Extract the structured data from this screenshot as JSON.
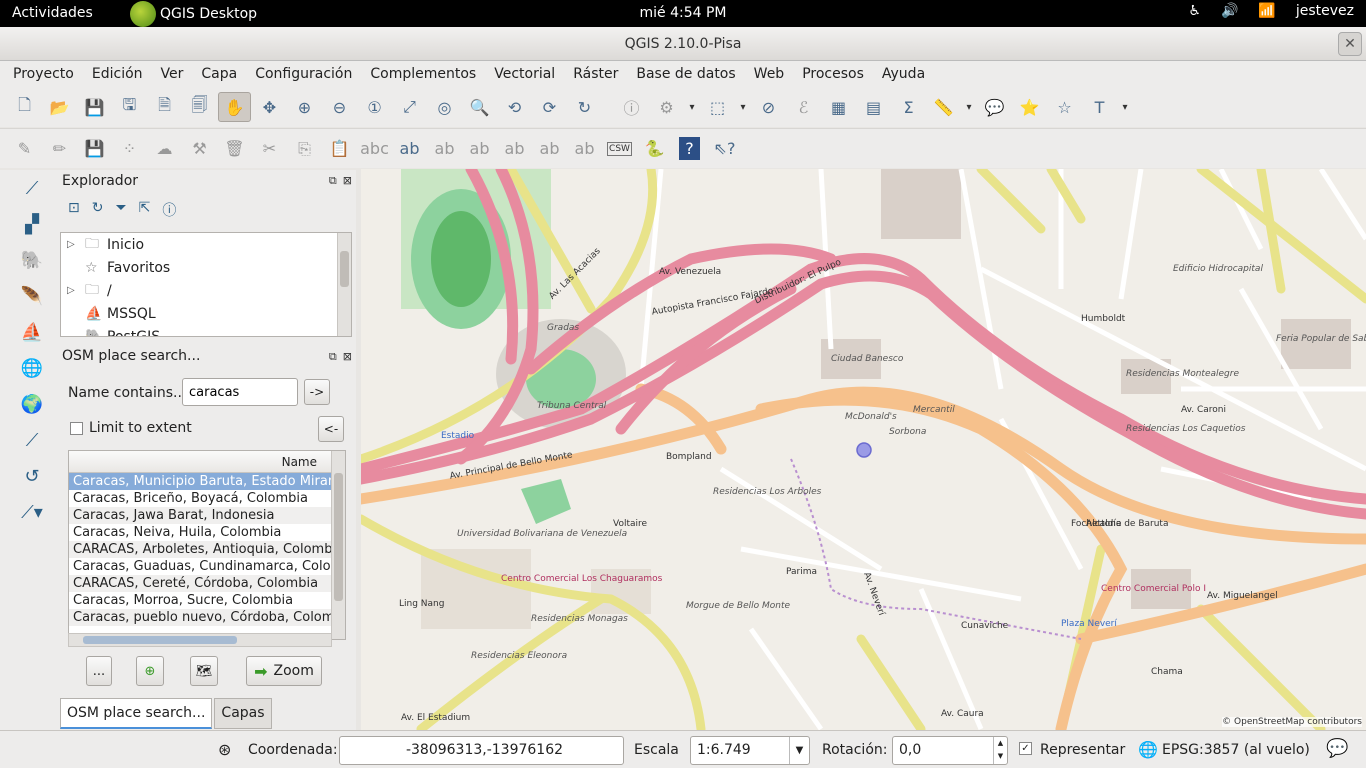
{
  "topbar": {
    "activities": "Actividades",
    "app_name": "QGIS Desktop",
    "clock": "mié  4:54 PM",
    "user": "jestevez"
  },
  "window": {
    "title": "QGIS 2.10.0-Pisa"
  },
  "menu": [
    "Proyecto",
    "Edición",
    "Ver",
    "Capa",
    "Configuración",
    "Complementos",
    "Vectorial",
    "Ráster",
    "Base de datos",
    "Web",
    "Procesos",
    "Ayuda"
  ],
  "toolbar2": {
    "csw_label": "CSW",
    "help_label": "?"
  },
  "explorer": {
    "title": "Explorador",
    "items": [
      {
        "label": "Inicio",
        "expandable": true
      },
      {
        "label": "Favoritos",
        "expandable": false
      },
      {
        "label": "/",
        "expandable": true
      },
      {
        "label": "MSSQL",
        "expandable": false
      },
      {
        "label": "PostGIS",
        "expandable": false
      }
    ]
  },
  "osm": {
    "title": "OSM place search...",
    "name_label": "Name contains...",
    "name_value": "caracas",
    "go_label": "->",
    "back_label": "<-",
    "limit_label": "Limit to extent",
    "column_header": "Name",
    "results": [
      "Caracas, Municipio Baruta, Estado Miranda",
      "Caracas, Briceño, Boyacá, Colombia",
      "Caracas, Jawa Barat, Indonesia",
      "Caracas, Neiva, Huila, Colombia",
      "CARACAS, Arboletes, Antioquia, Colombia",
      "Caracas, Guaduas, Cundinamarca, Colombia",
      "CARACAS, Cereté, Córdoba, Colombia",
      "Caracas, Morroa, Sucre, Colombia",
      "Caracas, pueblo nuevo, Córdoba, Colombia"
    ],
    "selected_index": 0,
    "more_label": "...",
    "zoom_label": "Zoom"
  },
  "dock_tabs": [
    "OSM place search...",
    "Capas"
  ],
  "map": {
    "labels": {
      "univ": "Universidad Bolivariana de Venezuela",
      "chaguaramos": "Centro Comercial Los Chaguaramos",
      "ciudad_banesco": "Ciudad Banesco",
      "mcdonalds": "McDonald's",
      "sorbona": "Sorbona",
      "mercantil": "Mercantil",
      "residencias_arboles": "Residencias Los Arboles",
      "tribuna_central": "Tribuna Central",
      "gradas": "Gradas",
      "estadio": "Estadio",
      "venezuela_ave": "Av. Venezuela",
      "autopista": "Autopista Francisco Fajardo",
      "distribuidor": "Distribuidor: El Pulpo",
      "principal": "Av. Principal de Bello Monte",
      "las_acacias": "Av. Las Acacias",
      "neveri": "Av. Neverí",
      "caroni": "Av. Caroni",
      "miguelangel": "Av. Miguelangel",
      "humboldt": "Humboldt",
      "plaza_neveri": "Plaza Neverí",
      "centro_polo": "Centro Comercial Polo I",
      "residencias_monagas": "Residencias Monagas",
      "residencias_elenora": "Residencias Eleonora",
      "lingnang": "Ling Nang",
      "alcaldia": "Alcaldía de Baruta",
      "fochettone": "Fochettone",
      "residencias_montealegre": "Residencias Montealegre",
      "feria": "Feria Popular de Sabana Grande",
      "caquetios": "Residencias Los Caquetios",
      "edificio_hidrocapital": "Edificio Hidrocapital",
      "bompland": "Bompland",
      "voltaire": "Voltaire",
      "parima": "Parima",
      "cunaviche": "Cunaviche",
      "chama": "Chama",
      "morgue": "Morgue de Bello Monte",
      "caura": "Av. Caura",
      "el_estadium": "Av. El Estadium"
    },
    "copyright": "© OpenStreetMap contributors"
  },
  "status": {
    "coord_label": "Coordenada:",
    "coord_value": "-38096313,-13976162",
    "scale_label": "Escala",
    "scale_value": "1:6.749",
    "rotation_label": "Rotación:",
    "rotation_value": "0,0",
    "render_label": "Representar",
    "crs_label": "EPSG:3857 (al vuelo)"
  }
}
